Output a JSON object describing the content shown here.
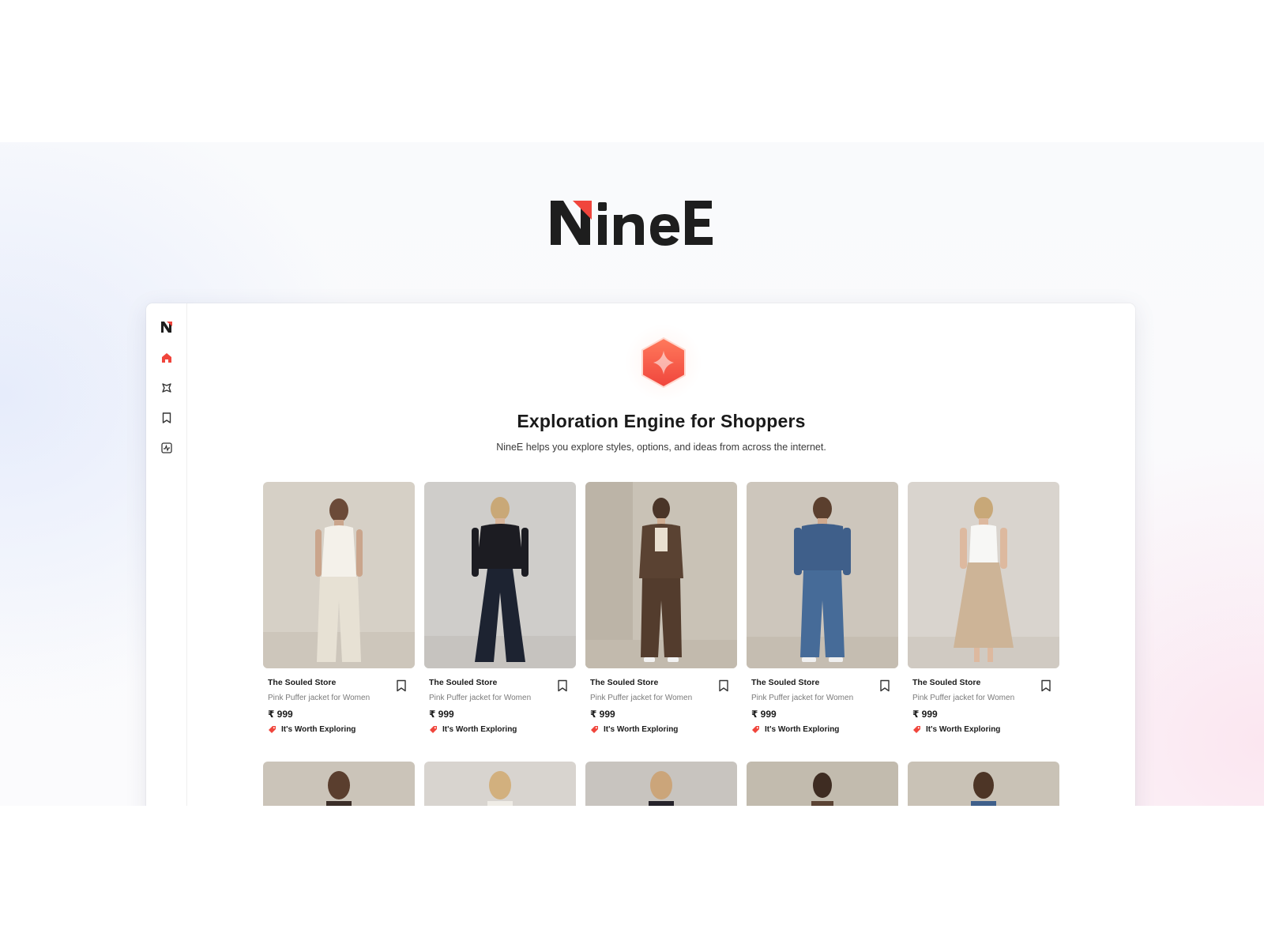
{
  "brand": {
    "name": "NineE",
    "accent": "#f0453c",
    "dark": "#1e1e1e"
  },
  "sidebar": {
    "items": [
      {
        "icon": "logo-mark-icon",
        "active": false
      },
      {
        "icon": "home-icon",
        "active": true
      },
      {
        "icon": "sparkle-icon",
        "active": false
      },
      {
        "icon": "bookmark-icon",
        "active": false
      },
      {
        "icon": "activity-icon",
        "active": false
      }
    ]
  },
  "hero": {
    "icon": "sparkle-hexagon-icon",
    "title": "Exploration Engine for Shoppers",
    "subtitle": "NineE helps you explore styles, options, and ideas from across the internet."
  },
  "products": [
    {
      "store": "The Souled Store",
      "name": "Pink Puffer jacket for Women",
      "price": "₹ 999",
      "tag": "It's Worth Exploring"
    },
    {
      "store": "The Souled Store",
      "name": "Pink Puffer jacket for Women",
      "price": "₹ 999",
      "tag": "It's Worth Exploring"
    },
    {
      "store": "The Souled Store",
      "name": "Pink Puffer jacket for Women",
      "price": "₹ 999",
      "tag": "It's Worth Exploring"
    },
    {
      "store": "The Souled Store",
      "name": "Pink Puffer jacket for Women",
      "price": "₹ 999",
      "tag": "It's Worth Exploring"
    },
    {
      "store": "The Souled Store",
      "name": "Pink Puffer jacket for Women",
      "price": "₹ 999",
      "tag": "It's Worth Exploring"
    }
  ]
}
